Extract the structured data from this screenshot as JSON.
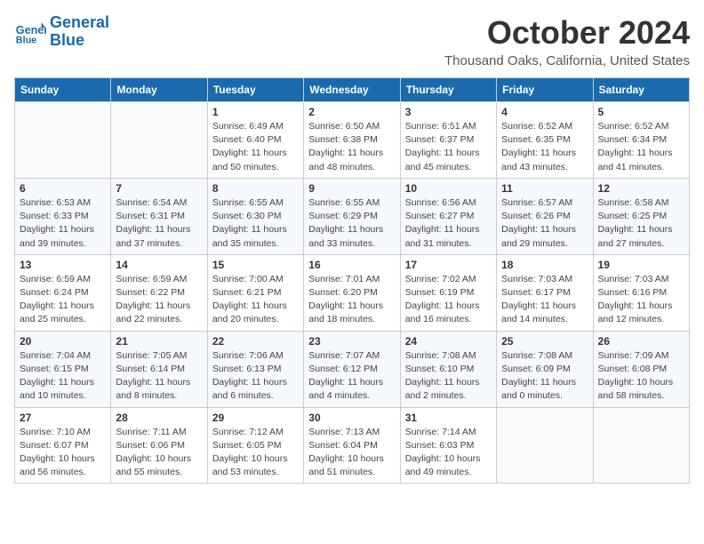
{
  "header": {
    "logo_line1": "General",
    "logo_line2": "Blue",
    "month_title": "October 2024",
    "subtitle": "Thousand Oaks, California, United States"
  },
  "days_of_week": [
    "Sunday",
    "Monday",
    "Tuesday",
    "Wednesday",
    "Thursday",
    "Friday",
    "Saturday"
  ],
  "weeks": [
    [
      {
        "day": "",
        "info": ""
      },
      {
        "day": "",
        "info": ""
      },
      {
        "day": "1",
        "info": "Sunrise: 6:49 AM\nSunset: 6:40 PM\nDaylight: 11 hours and 50 minutes."
      },
      {
        "day": "2",
        "info": "Sunrise: 6:50 AM\nSunset: 6:38 PM\nDaylight: 11 hours and 48 minutes."
      },
      {
        "day": "3",
        "info": "Sunrise: 6:51 AM\nSunset: 6:37 PM\nDaylight: 11 hours and 45 minutes."
      },
      {
        "day": "4",
        "info": "Sunrise: 6:52 AM\nSunset: 6:35 PM\nDaylight: 11 hours and 43 minutes."
      },
      {
        "day": "5",
        "info": "Sunrise: 6:52 AM\nSunset: 6:34 PM\nDaylight: 11 hours and 41 minutes."
      }
    ],
    [
      {
        "day": "6",
        "info": "Sunrise: 6:53 AM\nSunset: 6:33 PM\nDaylight: 11 hours and 39 minutes."
      },
      {
        "day": "7",
        "info": "Sunrise: 6:54 AM\nSunset: 6:31 PM\nDaylight: 11 hours and 37 minutes."
      },
      {
        "day": "8",
        "info": "Sunrise: 6:55 AM\nSunset: 6:30 PM\nDaylight: 11 hours and 35 minutes."
      },
      {
        "day": "9",
        "info": "Sunrise: 6:55 AM\nSunset: 6:29 PM\nDaylight: 11 hours and 33 minutes."
      },
      {
        "day": "10",
        "info": "Sunrise: 6:56 AM\nSunset: 6:27 PM\nDaylight: 11 hours and 31 minutes."
      },
      {
        "day": "11",
        "info": "Sunrise: 6:57 AM\nSunset: 6:26 PM\nDaylight: 11 hours and 29 minutes."
      },
      {
        "day": "12",
        "info": "Sunrise: 6:58 AM\nSunset: 6:25 PM\nDaylight: 11 hours and 27 minutes."
      }
    ],
    [
      {
        "day": "13",
        "info": "Sunrise: 6:59 AM\nSunset: 6:24 PM\nDaylight: 11 hours and 25 minutes."
      },
      {
        "day": "14",
        "info": "Sunrise: 6:59 AM\nSunset: 6:22 PM\nDaylight: 11 hours and 22 minutes."
      },
      {
        "day": "15",
        "info": "Sunrise: 7:00 AM\nSunset: 6:21 PM\nDaylight: 11 hours and 20 minutes."
      },
      {
        "day": "16",
        "info": "Sunrise: 7:01 AM\nSunset: 6:20 PM\nDaylight: 11 hours and 18 minutes."
      },
      {
        "day": "17",
        "info": "Sunrise: 7:02 AM\nSunset: 6:19 PM\nDaylight: 11 hours and 16 minutes."
      },
      {
        "day": "18",
        "info": "Sunrise: 7:03 AM\nSunset: 6:17 PM\nDaylight: 11 hours and 14 minutes."
      },
      {
        "day": "19",
        "info": "Sunrise: 7:03 AM\nSunset: 6:16 PM\nDaylight: 11 hours and 12 minutes."
      }
    ],
    [
      {
        "day": "20",
        "info": "Sunrise: 7:04 AM\nSunset: 6:15 PM\nDaylight: 11 hours and 10 minutes."
      },
      {
        "day": "21",
        "info": "Sunrise: 7:05 AM\nSunset: 6:14 PM\nDaylight: 11 hours and 8 minutes."
      },
      {
        "day": "22",
        "info": "Sunrise: 7:06 AM\nSunset: 6:13 PM\nDaylight: 11 hours and 6 minutes."
      },
      {
        "day": "23",
        "info": "Sunrise: 7:07 AM\nSunset: 6:12 PM\nDaylight: 11 hours and 4 minutes."
      },
      {
        "day": "24",
        "info": "Sunrise: 7:08 AM\nSunset: 6:10 PM\nDaylight: 11 hours and 2 minutes."
      },
      {
        "day": "25",
        "info": "Sunrise: 7:08 AM\nSunset: 6:09 PM\nDaylight: 11 hours and 0 minutes."
      },
      {
        "day": "26",
        "info": "Sunrise: 7:09 AM\nSunset: 6:08 PM\nDaylight: 10 hours and 58 minutes."
      }
    ],
    [
      {
        "day": "27",
        "info": "Sunrise: 7:10 AM\nSunset: 6:07 PM\nDaylight: 10 hours and 56 minutes."
      },
      {
        "day": "28",
        "info": "Sunrise: 7:11 AM\nSunset: 6:06 PM\nDaylight: 10 hours and 55 minutes."
      },
      {
        "day": "29",
        "info": "Sunrise: 7:12 AM\nSunset: 6:05 PM\nDaylight: 10 hours and 53 minutes."
      },
      {
        "day": "30",
        "info": "Sunrise: 7:13 AM\nSunset: 6:04 PM\nDaylight: 10 hours and 51 minutes."
      },
      {
        "day": "31",
        "info": "Sunrise: 7:14 AM\nSunset: 6:03 PM\nDaylight: 10 hours and 49 minutes."
      },
      {
        "day": "",
        "info": ""
      },
      {
        "day": "",
        "info": ""
      }
    ]
  ]
}
